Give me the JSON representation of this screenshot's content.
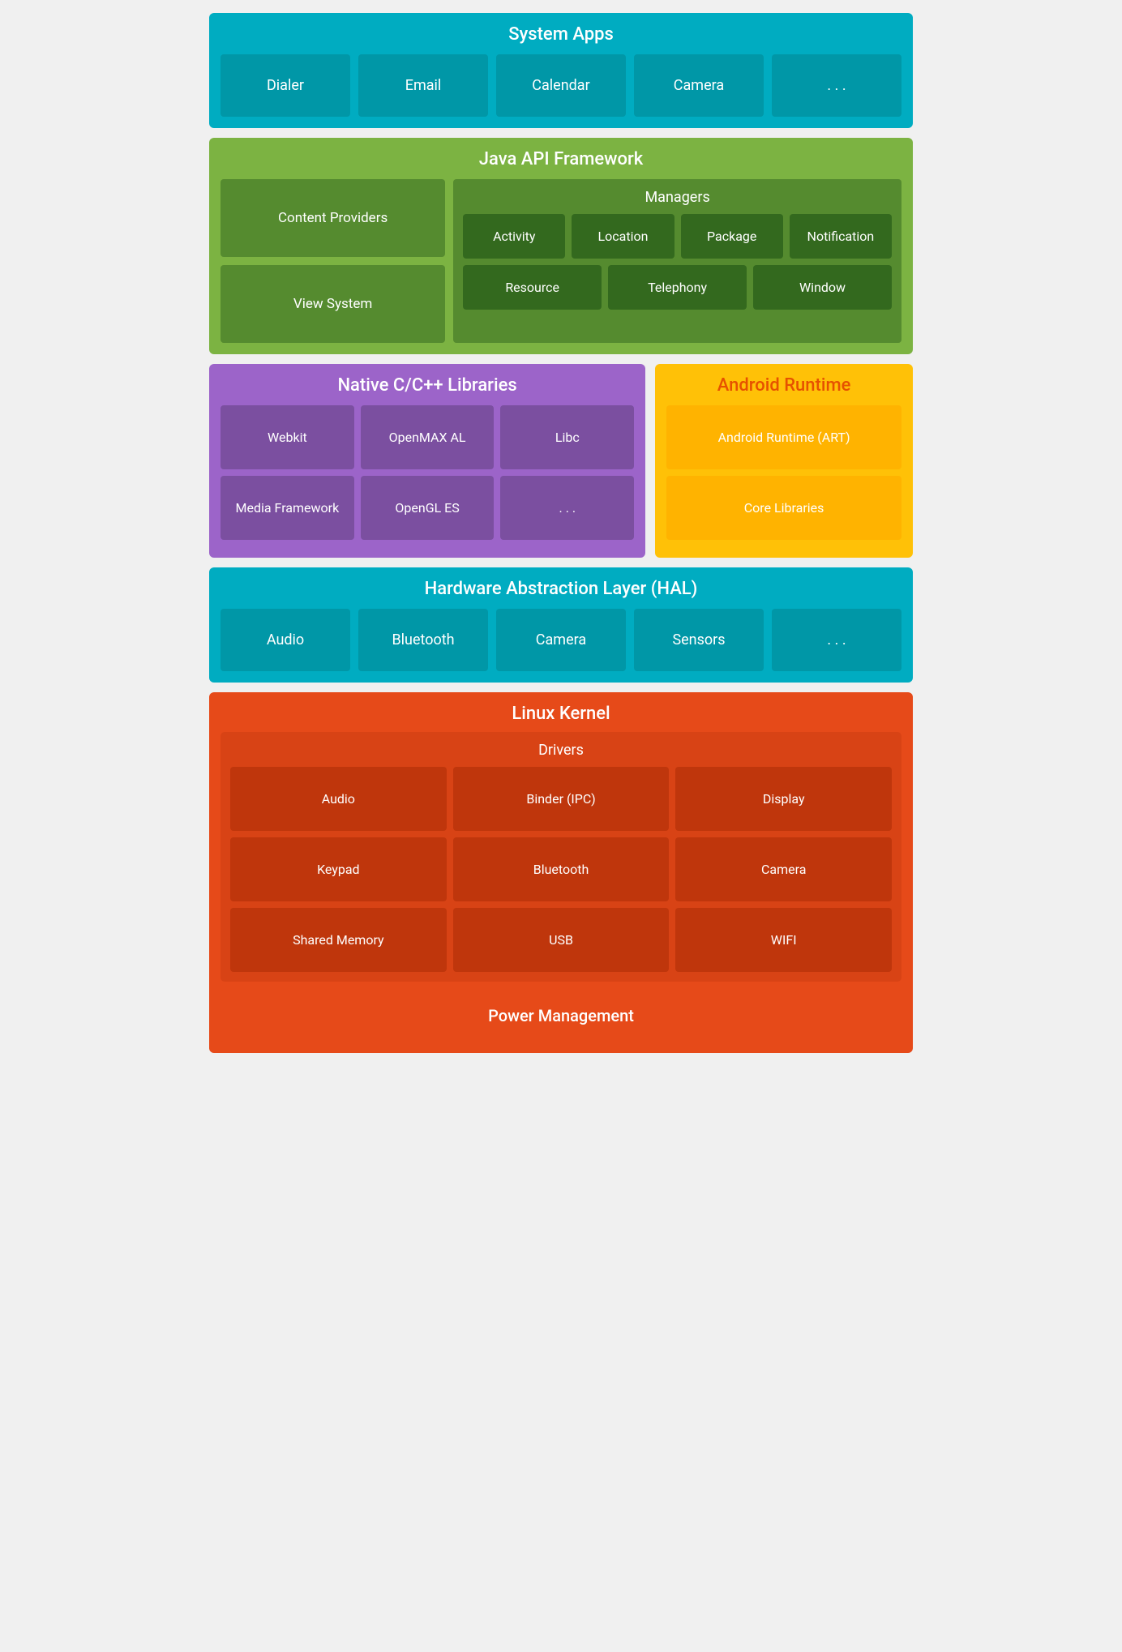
{
  "systemApps": {
    "title": "System Apps",
    "apps": [
      "Dialer",
      "Email",
      "Calendar",
      "Camera",
      ". . ."
    ]
  },
  "javaApi": {
    "title": "Java API Framework",
    "leftItems": [
      "Content Providers",
      "View System"
    ],
    "managers": {
      "title": "Managers",
      "row1": [
        "Activity",
        "Location",
        "Package",
        "Notification"
      ],
      "row2": [
        "Resource",
        "Telephony",
        "Window"
      ]
    }
  },
  "nativeLibs": {
    "title": "Native C/C++ Libraries",
    "row1": [
      "Webkit",
      "OpenMAX AL",
      "Libc"
    ],
    "row2": [
      "Media Framework",
      "OpenGL ES",
      ". . ."
    ]
  },
  "androidRuntime": {
    "title": "Android Runtime",
    "items": [
      "Android Runtime (ART)",
      "Core Libraries"
    ]
  },
  "hal": {
    "title": "Hardware Abstraction Layer (HAL)",
    "items": [
      "Audio",
      "Bluetooth",
      "Camera",
      "Sensors",
      ". . ."
    ]
  },
  "linuxKernel": {
    "title": "Linux Kernel",
    "drivers": {
      "title": "Drivers",
      "row1": [
        "Audio",
        "Binder (IPC)",
        "Display"
      ],
      "row2": [
        "Keypad",
        "Bluetooth",
        "Camera"
      ],
      "row3": [
        "Shared Memory",
        "USB",
        "WIFI"
      ]
    },
    "powerManagement": "Power Management"
  }
}
